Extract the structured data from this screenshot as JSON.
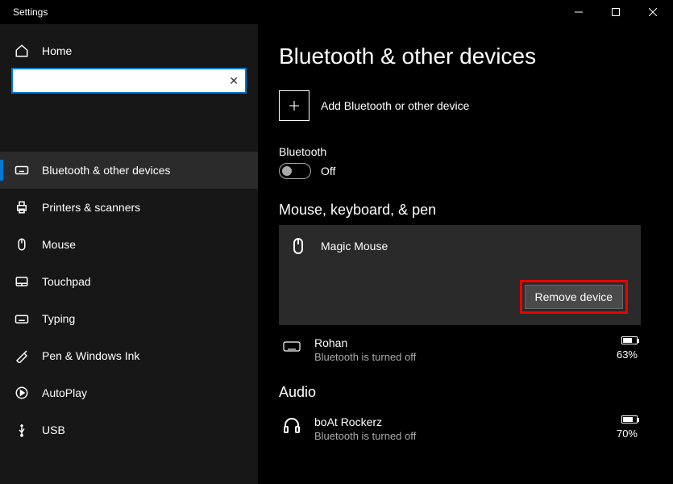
{
  "window": {
    "title": "Settings"
  },
  "sidebar": {
    "home": "Home",
    "items": [
      {
        "label": "Bluetooth & other devices"
      },
      {
        "label": "Printers & scanners"
      },
      {
        "label": "Mouse"
      },
      {
        "label": "Touchpad"
      },
      {
        "label": "Typing"
      },
      {
        "label": "Pen & Windows Ink"
      },
      {
        "label": "AutoPlay"
      },
      {
        "label": "USB"
      }
    ]
  },
  "main": {
    "title": "Bluetooth & other devices",
    "add_label": "Add Bluetooth or other device",
    "bt_label": "Bluetooth",
    "bt_state": "Off",
    "sections": {
      "mkp": {
        "header": "Mouse, keyboard, & pen",
        "devices": [
          {
            "name": "Magic  Mouse",
            "remove_label": "Remove device"
          },
          {
            "name": "Rohan",
            "status": "Bluetooth is turned off",
            "battery": "63%"
          }
        ]
      },
      "audio": {
        "header": "Audio",
        "devices": [
          {
            "name": "boAt Rockerz",
            "status": "Bluetooth is turned off",
            "battery": "70%"
          }
        ]
      }
    }
  }
}
